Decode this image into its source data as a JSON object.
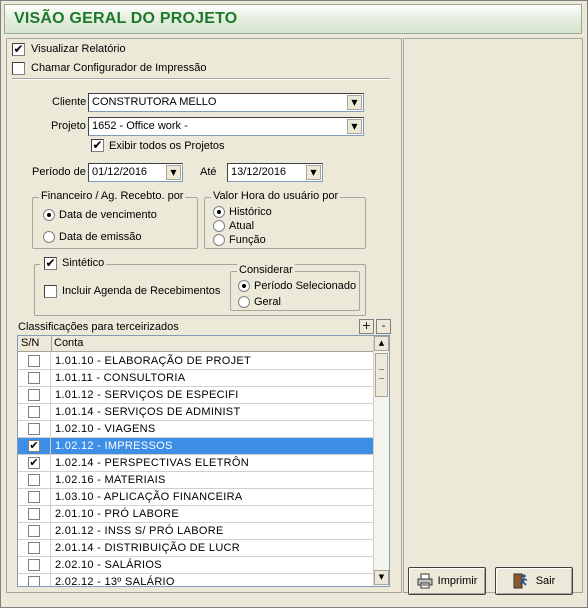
{
  "window": {
    "title": "VISÃO GERAL DO PROJETO"
  },
  "options": {
    "visualizar_relatorio": {
      "label": "Visualizar Relatório",
      "checked": true
    },
    "chamar_configurador": {
      "label": "Chamar Configurador de Impressão",
      "checked": false
    }
  },
  "filters": {
    "cliente_label": "Cliente",
    "cliente_value": "CONSTRUTORA MELLO",
    "projeto_label": "Projeto",
    "projeto_value": "1652 - Office work -",
    "exibir_todos_label": "Exibir todos os Projetos",
    "exibir_todos_checked": true,
    "periodo_label": "Período de",
    "periodo_de": "01/12/2016",
    "ate_label": "Até",
    "periodo_ate": "13/12/2016"
  },
  "financeiro": {
    "title": "Financeiro / Ag. Recebto. por",
    "options": [
      "Data de vencimento",
      "Data de emissão"
    ],
    "selected": "Data de vencimento"
  },
  "valor_hora": {
    "title": "Valor Hora do usuário por",
    "options": [
      "Histórico",
      "Atual",
      "Função"
    ],
    "selected": "Histórico"
  },
  "sintetico": {
    "label": "Sintético",
    "checked": true,
    "incluir_agenda_label": "Incluir Agenda de  Recebimentos",
    "incluir_agenda_checked": false,
    "considerar": {
      "title": "Considerar",
      "options": [
        "Período Selecionado",
        "Geral"
      ],
      "selected": "Período Selecionado"
    }
  },
  "classificacoes": {
    "title": "Classificações para terceirizados",
    "plus_label": "+",
    "minus_label": "-",
    "columns": [
      "S/N",
      "Conta"
    ],
    "rows": [
      {
        "checked": false,
        "conta": "1.01.10 - ELABORAÇÃO DE PROJET"
      },
      {
        "checked": false,
        "conta": "1.01.11 - CONSULTORIA"
      },
      {
        "checked": false,
        "conta": "1.01.12 - SERVIÇOS DE ESPECIFI"
      },
      {
        "checked": false,
        "conta": "1.01.14 - SERVIÇOS DE ADMINIST"
      },
      {
        "checked": false,
        "conta": "1.02.10 - VIAGENS"
      },
      {
        "checked": true,
        "conta": "1.02.12 - IMPRESSOS",
        "selected": true
      },
      {
        "checked": true,
        "conta": "1.02.14 - PERSPECTIVAS ELETRÔN"
      },
      {
        "checked": false,
        "conta": "1.02.16 - MATERIAIS"
      },
      {
        "checked": false,
        "conta": "1.03.10 - APLICAÇÃO FINANCEIRA"
      },
      {
        "checked": false,
        "conta": "2.01.10 - PRÓ LABORE"
      },
      {
        "checked": false,
        "conta": "2.01.12 - INSS S/ PRÓ LABORE"
      },
      {
        "checked": false,
        "conta": "2.01.14 - DISTRIBUIÇÃO DE LUCR"
      },
      {
        "checked": false,
        "conta": "2.02.10 - SALÁRIOS"
      },
      {
        "checked": false,
        "conta": "2.02.12 - 13º SALÁRIO"
      }
    ]
  },
  "actions": {
    "imprimir_label": "Imprimir",
    "sair_label": "Sair"
  },
  "colors": {
    "title_text": "#1d7a2a",
    "selection": "#3d8ee6",
    "background": "#ece9d8"
  }
}
